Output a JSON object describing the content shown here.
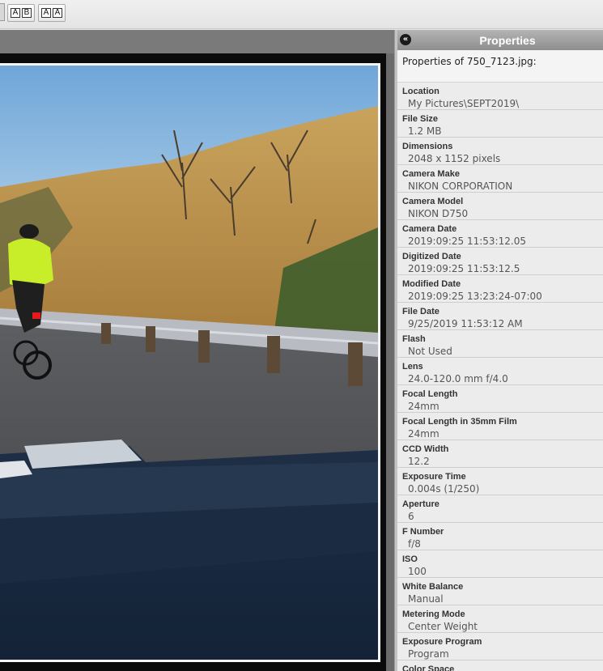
{
  "toolbar": {
    "ab_button": {
      "left": "A",
      "right": "B"
    },
    "aa_button": {
      "left": "A",
      "right": "A"
    }
  },
  "viewer": {
    "image_subject": "cyclist on mountain road"
  },
  "properties": {
    "title": "Properties",
    "collapse_glyph": "«",
    "file_caption": "Properties of 750_7123.jpg:",
    "items": [
      {
        "label": "Location",
        "value": "My Pictures\\SEPT2019\\"
      },
      {
        "label": "File Size",
        "value": "1.2 MB"
      },
      {
        "label": "Dimensions",
        "value": "2048 x 1152 pixels"
      },
      {
        "label": "Camera Make",
        "value": "NIKON CORPORATION"
      },
      {
        "label": "Camera Model",
        "value": "NIKON D750"
      },
      {
        "label": "Camera Date",
        "value": "2019:09:25 11:53:12.05"
      },
      {
        "label": "Digitized Date",
        "value": "2019:09:25 11:53:12.5"
      },
      {
        "label": "Modified Date",
        "value": "2019:09:25 13:23:24-07:00"
      },
      {
        "label": "File Date",
        "value": "9/25/2019 11:53:12 AM"
      },
      {
        "label": "Flash",
        "value": "Not Used"
      },
      {
        "label": "Lens",
        "value": "24.0-120.0 mm f/4.0"
      },
      {
        "label": "Focal Length",
        "value": "24mm"
      },
      {
        "label": "Focal Length in 35mm Film",
        "value": "24mm"
      },
      {
        "label": "CCD Width",
        "value": "12.2"
      },
      {
        "label": "Exposure Time",
        "value": "0.004s (1/250)"
      },
      {
        "label": "Aperture",
        "value": "6"
      },
      {
        "label": "F Number",
        "value": "f/8"
      },
      {
        "label": "ISO",
        "value": "100"
      },
      {
        "label": "White Balance",
        "value": "Manual"
      },
      {
        "label": "Metering Mode",
        "value": "Center Weight"
      },
      {
        "label": "Exposure Program",
        "value": "Program"
      },
      {
        "label": "Color Space",
        "value": ""
      }
    ]
  }
}
